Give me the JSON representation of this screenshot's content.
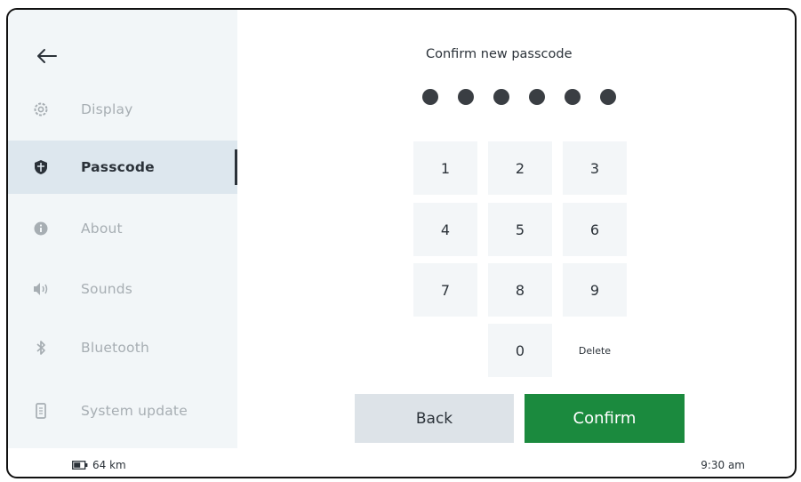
{
  "sidebar": {
    "back_icon": "arrow-left-icon",
    "items": [
      {
        "label": "Display",
        "icon": "gear-icon",
        "active": false
      },
      {
        "label": "Passcode",
        "icon": "shield-icon",
        "active": true
      },
      {
        "label": "About",
        "icon": "info-circle-icon",
        "active": false
      },
      {
        "label": "Sounds",
        "icon": "speaker-icon",
        "active": false
      },
      {
        "label": "Bluetooth",
        "icon": "bluetooth-icon",
        "active": false
      },
      {
        "label": "System update",
        "icon": "phone-update-icon",
        "active": false
      }
    ]
  },
  "passcode": {
    "title": "Confirm new passcode",
    "entered_digits": 6,
    "keys": [
      "1",
      "2",
      "3",
      "4",
      "5",
      "6",
      "7",
      "8",
      "9",
      "0",
      "Delete"
    ]
  },
  "actions": {
    "back_label": "Back",
    "confirm_label": "Confirm"
  },
  "status": {
    "battery_icon": "battery-icon",
    "range": "64 km",
    "time": "9:30 am"
  },
  "colors": {
    "sidebar_bg": "#f2f6f8",
    "active_item_bg": "#dde7ee",
    "confirm": "#1b8a3e",
    "key_bg": "#f3f6f8"
  }
}
